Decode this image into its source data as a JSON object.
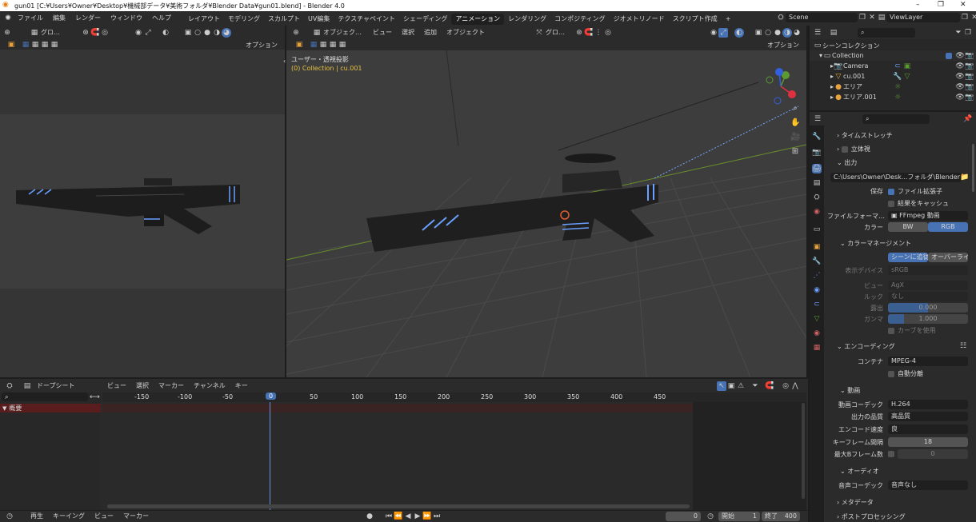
{
  "window": {
    "title": "gun01 [C:¥Users¥Owner¥Desktop¥機械部データ¥美術フォルダ¥Blender Data¥gun01.blend] - Blender 4.0",
    "minimize": "–",
    "restore": "❐",
    "close": "✕"
  },
  "menu": [
    "ファイル",
    "編集",
    "レンダー",
    "ウィンドウ",
    "ヘルプ"
  ],
  "workspaces": [
    "レイアウト",
    "モデリング",
    "スカルプト",
    "UV編集",
    "テクスチャペイント",
    "シェーディング",
    "アニメーション",
    "レンダリング",
    "コンポジティング",
    "ジオメトリノード",
    "スクリプト作成",
    "+"
  ],
  "active_workspace": "アニメーション",
  "scene": {
    "name": "Scene",
    "viewlayer": "ViewLayer"
  },
  "camera_view": {
    "mode": "グロ…",
    "option": "オプション"
  },
  "viewport": {
    "mode": "オブジェク…",
    "menus": [
      "ビュー",
      "選択",
      "追加",
      "オブジェクト"
    ],
    "orientation": "グロ…",
    "option": "オプション",
    "view_label": "ユーザー・透視投影",
    "collection_label": "(0) Collection | cu.001"
  },
  "outliner": {
    "root": "シーンコレクション",
    "collection": "Collection",
    "items": [
      "Camera",
      "cu.001",
      "エリア",
      "エリア.001"
    ]
  },
  "properties": {
    "sections": {
      "time_stretch": "タイムストレッチ",
      "stereo": "立体視",
      "output": "出力",
      "color_mgmt": "カラーマネージメント",
      "encoding": "エンコーディング",
      "video": "動画",
      "audio": "オーディオ",
      "metadata": "メタデータ",
      "post": "ポストプロセッシング"
    },
    "output_path": "C:\\Users\\Owner\\Desk...フォルダ\\Blender Data\\",
    "save_label": "保存",
    "file_ext": "ファイル拡張子",
    "cache": "結果をキャッシュ",
    "file_format_label": "ファイルフォーマ…",
    "file_format": "FFmpeg 動画",
    "color_label": "カラー",
    "bw": "BW",
    "rgb": "RGB",
    "follow_scene": "シーンに追従",
    "override": "オーバーライ…",
    "display_device_label": "表示デバイス",
    "display_device": "sRGB",
    "view_label": "ビュー",
    "view": "AgX",
    "look_label": "ルック",
    "look": "なし",
    "exposure_label": "露出",
    "exposure": "0.000",
    "gamma_label": "ガンマ",
    "gamma": "1.000",
    "curves": "カーブを使用",
    "container_label": "コンテナ",
    "container": "MPEG-4",
    "autosplit": "自動分離",
    "codec_label": "動画コーデック",
    "codec": "H.264",
    "quality_label": "出力の品質",
    "quality": "高品質",
    "speed_label": "エンコード速度",
    "speed": "良",
    "keyframe_label": "キーフレーム間隔",
    "keyframe": "18",
    "bframe_label": "最大Bフレーム数",
    "bframe": "0",
    "audio_codec_label": "音声コーデック",
    "audio_codec": "音声なし"
  },
  "dopesheet": {
    "mode": "ドープシート",
    "menus": [
      "ビュー",
      "選択",
      "マーカー",
      "チャンネル",
      "キー"
    ],
    "ticks": [
      "-150",
      "-100",
      "-50",
      "0",
      "50",
      "100",
      "150",
      "200",
      "250",
      "300",
      "350",
      "400",
      "450"
    ],
    "summary": "概要"
  },
  "timeline": {
    "menus": [
      "再生",
      "キーイング",
      "ビュー",
      "マーカー"
    ],
    "frame": "0",
    "start_label": "開始",
    "start": "1",
    "end_label": "終了",
    "end": "400"
  }
}
